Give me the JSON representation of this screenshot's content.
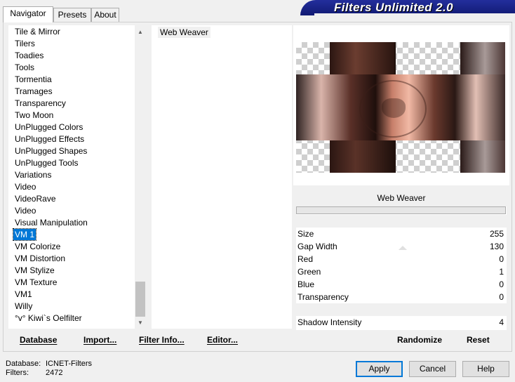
{
  "tabs": {
    "navigator": "Navigator",
    "presets": "Presets",
    "about": "About"
  },
  "banner": {
    "title": "Filters Unlimited 2.0"
  },
  "categories": {
    "items": [
      "Tile & Mirror",
      "Tilers",
      "Toadies",
      "Tools",
      "Tormentia",
      "Tramages",
      "Transparency",
      "Two Moon",
      "UnPlugged Colors",
      "UnPlugged Effects",
      "UnPlugged Shapes",
      "UnPlugged Tools",
      "Variations",
      "Video",
      "VideoRave",
      "Video",
      "Visual Manipulation",
      "VM 1",
      "VM Colorize",
      "VM Distortion",
      "VM Stylize",
      "VM Texture",
      "VM1",
      "Willy",
      "°v° Kiwi`s Oelfilter"
    ],
    "selected": "VM 1"
  },
  "filters": {
    "items": [
      "Web Weaver"
    ]
  },
  "params": {
    "header": "Web Weaver",
    "rows": [
      {
        "name": "Size",
        "value": "255"
      },
      {
        "name": "Gap Width",
        "value": "130"
      },
      {
        "name": "Red",
        "value": "0"
      },
      {
        "name": "Green",
        "value": "1"
      },
      {
        "name": "Blue",
        "value": "0"
      },
      {
        "name": "Transparency",
        "value": "0"
      }
    ],
    "shadow": {
      "name": "Shadow Intensity",
      "value": "4"
    }
  },
  "bottom_bar": {
    "database": "Database",
    "import": "Import...",
    "filter_info": "Filter Info...",
    "editor": "Editor...",
    "randomize": "Randomize",
    "reset": "Reset"
  },
  "footer": {
    "database_label": "Database:",
    "database_value": "ICNET-Filters",
    "filters_label": "Filters:",
    "filters_value": "2472"
  },
  "buttons": {
    "apply": "Apply",
    "cancel": "Cancel",
    "help": "Help"
  },
  "colors": {
    "accent": "#0078d7",
    "banner": "#1a237e"
  }
}
